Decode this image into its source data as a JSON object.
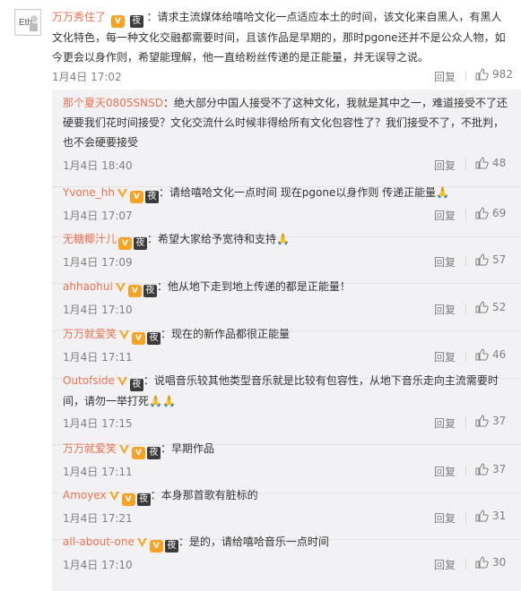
{
  "main_comment": {
    "username": "万万秀住了",
    "text": "：请求主流媒体给嘻哈文化一点适应本土的时间，该文化来自黑人，有黑人文化特色，每一种文化交融都需要时间，且该作品是早期的，那时pgone还并不是公众人物，如今更会以身作则，希望能理解，他一直给粉丝传递的是正能量，并无误导之说。",
    "time": "1月4日 17:02",
    "reply_label": "回复",
    "likes": "982"
  },
  "replies": [
    {
      "username": "那个夏天0805SNSD",
      "badges": [],
      "text": "：绝大部分中国人接受不了这种文化，我就是其中之一，难道接受不了还硬要我们花时间接受？文化交流什么时候非得给所有文化包容性了？我们接受不了，不批判，也不会硬要接受",
      "time": "1月4日 18:40",
      "reply_label": "回复",
      "likes": "48"
    },
    {
      "username": "Yvone_hh",
      "badges": [
        "v",
        "vip",
        "night"
      ],
      "text": "：请给嘻哈文化一点时间 现在pgone以身作则 传递正能量🙏",
      "time": "1月4日 17:07",
      "reply_label": "回复",
      "likes": "69"
    },
    {
      "username": "无糖椰汁儿",
      "badges": [
        "vip",
        "night"
      ],
      "text": "：希望大家给予宽待和支持🙏",
      "time": "1月4日 17:09",
      "reply_label": "回复",
      "likes": "57"
    },
    {
      "username": "ahhaohui",
      "badges": [
        "v",
        "vip",
        "night"
      ],
      "text": "：他从地下走到地上传递的都是正能量！",
      "time": "1月4日 17:10",
      "reply_label": "回复",
      "likes": "52"
    },
    {
      "username": "万万就爱笑",
      "badges": [
        "v",
        "vip",
        "night"
      ],
      "text": "：现在的新作品都很正能量",
      "time": "1月4日 17:11",
      "reply_label": "回复",
      "likes": "46"
    },
    {
      "username": "Outofside",
      "badges": [
        "v",
        "night"
      ],
      "text": "：说唱音乐较其他类型音乐就是比较有包容性，从地下音乐走向主流需要时间，请勿一举打死🙏🙏",
      "time": "1月4日 17:15",
      "reply_label": "回复",
      "likes": "37"
    },
    {
      "username": "万万就爱笑",
      "badges": [
        "v",
        "vip",
        "night"
      ],
      "text": "：早期作品",
      "time": "1月4日 17:11",
      "reply_label": "回复",
      "likes": "37"
    },
    {
      "username": "Amoyex",
      "badges": [
        "v",
        "vip",
        "night"
      ],
      "text": "：本身那首歌有脏标的",
      "time": "1月4日 17:21",
      "reply_label": "回复",
      "likes": "31"
    },
    {
      "username": "all-about-one",
      "badges": [
        "v",
        "vip",
        "night"
      ],
      "text": "：是的，请给嘻哈音乐一点时间",
      "time": "1月4日 17:10",
      "reply_label": "回复",
      "likes": "30"
    }
  ],
  "badge_glyphs": {
    "vip": "V",
    "night": "夜"
  },
  "colors": {
    "username": "#eb7350",
    "text": "#333333",
    "meta": "#808080",
    "reply_bg": "#f2f2f5",
    "vip": "#f6a323",
    "night": "#3b3b3b"
  }
}
